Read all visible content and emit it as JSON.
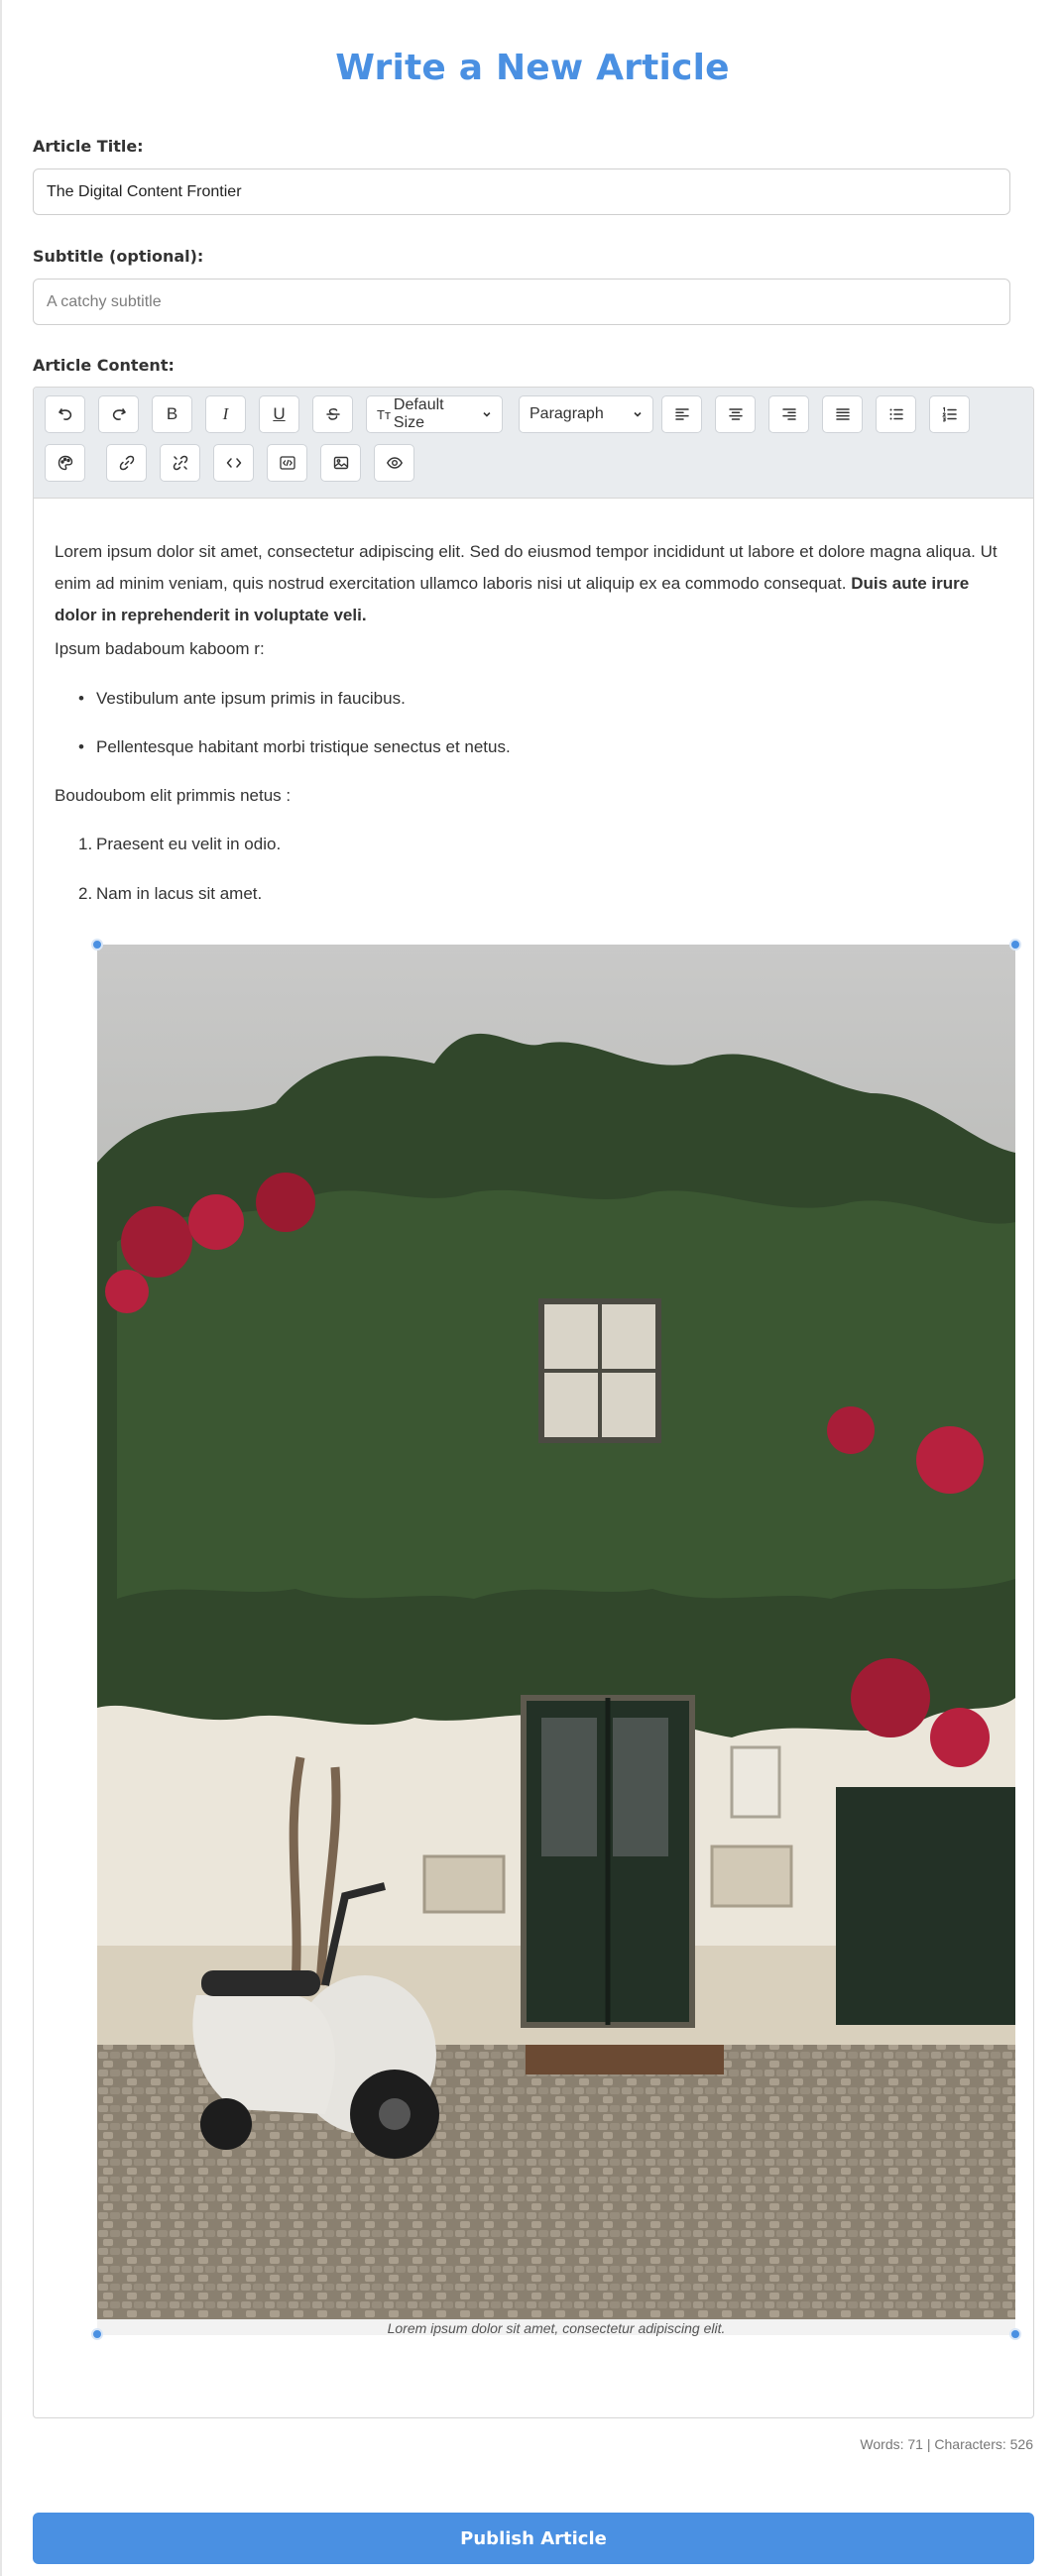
{
  "page": {
    "title": "Write a New Article"
  },
  "form": {
    "title_label": "Article Title:",
    "title_value": "The Digital Content Frontier",
    "subtitle_label": "Subtitle (optional):",
    "subtitle_value": "",
    "subtitle_placeholder": "A catchy subtitle",
    "content_label": "Article Content:"
  },
  "toolbar": {
    "row1": [
      "undo-icon",
      "redo-icon",
      "bold-icon",
      "italic-icon",
      "underline-icon",
      "strikethrough-icon"
    ],
    "font_size_prefix": "Tт",
    "font_size_value": "Default Size",
    "block_format_value": "Paragraph",
    "align": [
      "align-left-icon",
      "align-center-icon",
      "align-right-icon",
      "align-justify-icon"
    ],
    "lists": [
      "bullet-list-icon",
      "numbered-list-icon"
    ],
    "row2": [
      "palette-icon",
      "link-icon",
      "unlink-icon",
      "code-icon",
      "code-block-icon",
      "image-icon",
      "preview-icon"
    ],
    "bold_letter": "B",
    "italic_letter": "I",
    "underline_letter": "U"
  },
  "content": {
    "p1": "Lorem ipsum dolor sit amet, consectetur adipiscing elit. Sed do eiusmod tempor incididunt ut labore et dolore magna aliqua. Ut enim ad minim veniam, quis nostrud exercitation ullamco laboris nisi ut aliquip ex ea commodo consequat.",
    "p1_bold": "Duis aute irure dolor in reprehenderit in voluptate veli.",
    "p2": "Ipsum badaboum kaboom r:",
    "bullets": [
      "Vestibulum ante ipsum primis in faucibus.",
      "Pellentesque habitant morbi tristique senectus et netus."
    ],
    "p3": "Boudoubom elit primmis netus :",
    "numbered": [
      "Praesent eu velit in odio.",
      "Nam in lacus sit amet."
    ],
    "numbered_markers": [
      "1.",
      "2."
    ],
    "bullet_marker": "•",
    "image_caption": "Lorem ipsum dolor sit amet, consectetur adipiscing elit."
  },
  "footer": {
    "word_count": "Words: 71 | Characters: 526",
    "publish_label": "Publish Article"
  },
  "colors": {
    "accent": "#4a90e2",
    "toolbar_bg": "#e9ecef"
  }
}
